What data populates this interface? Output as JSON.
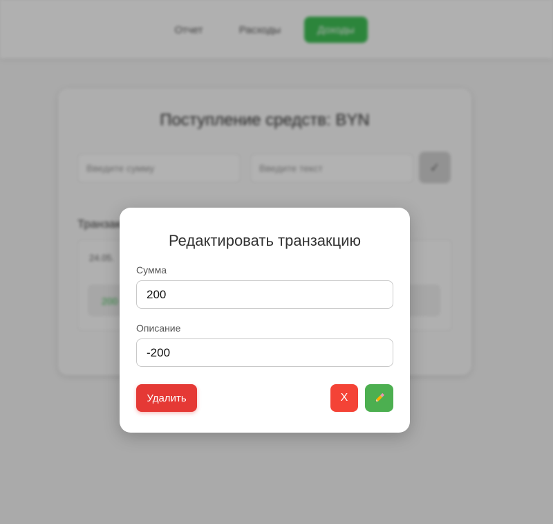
{
  "nav": {
    "items": [
      {
        "label": "Отчет"
      },
      {
        "label": "Расходы"
      },
      {
        "label": "Доходы",
        "active": true
      }
    ]
  },
  "background": {
    "card_title": "Поступление средств: BYN",
    "amount_placeholder": "Введите сумму",
    "text_placeholder": "Введите текст",
    "confirm_icon": "checkmark-icon",
    "section_title": "Транзакции",
    "date": "24.05.",
    "row_amount": "200"
  },
  "modal": {
    "title": "Редактировать транзакцию",
    "sum_label": "Сумма",
    "sum_value": "200",
    "description_label": "Описание",
    "description_value": "-200",
    "delete_label": "Удалить",
    "close_label": "X",
    "save_icon": "pencil-icon"
  },
  "colors": {
    "accent_green": "#4caf50",
    "danger_red": "#e53935",
    "close_red": "#f44336"
  }
}
